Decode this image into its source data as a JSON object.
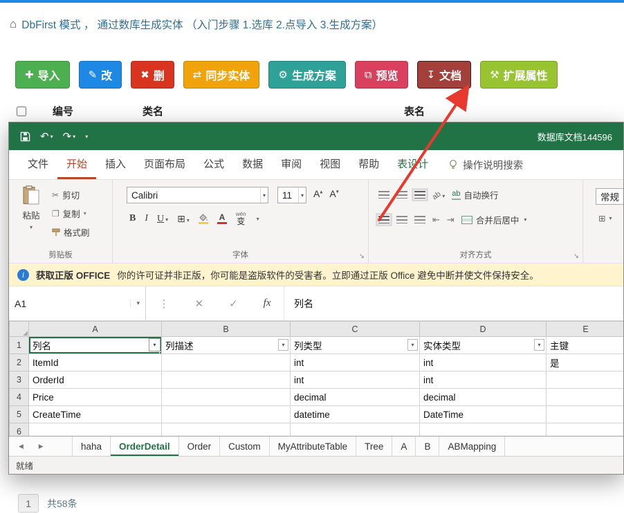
{
  "colors": {
    "top_strip": "#1E88E5",
    "excel_green": "#217346",
    "active_ribbon_tab": "#B7472A",
    "warning_bg": "#FFF4CE",
    "btn_import": "#4CAF50",
    "btn_modify": "#1E88E5",
    "btn_delete": "#D9341F",
    "btn_sync": "#F0A30A",
    "btn_generate": "#2FA199",
    "btn_preview": "#D8405D",
    "btn_doc": "#A3403C",
    "btn_extend": "#97C430",
    "annotation_arrow": "#E8392E",
    "font_color_swatch": "#D32F2F",
    "fill_color_swatch": "#F2CE3A"
  },
  "icons": {
    "home": "⌂",
    "plus": "✚",
    "edit": "✎",
    "delete": "✖",
    "sync": "⇄",
    "gear": "⚙",
    "preview": "⧉",
    "download": "↧",
    "extend": "⚒",
    "undo": "↶",
    "redo": "↷",
    "dropdown": "▾",
    "cut": "✂",
    "copy": "❐",
    "borders": "⊞",
    "nav_left": "◂",
    "nav_right": "▸",
    "cancel": "✕",
    "confirm": "✓",
    "dots": "⋮",
    "launcher": "↘",
    "corner_triangle": "◢",
    "indent_decrease": "⇤",
    "indent_increase": "⇥",
    "letter_a": "A",
    "grow_mark": "▴",
    "shrink_mark": "▾"
  },
  "page": {
    "header_title": "DbFirst 模式 ，  通过数库生成实体 （入门步骤 1.选库 2.点导入 3.生成方案）",
    "toolbar": {
      "buttons": [
        {
          "label": "导入"
        },
        {
          "label": "改"
        },
        {
          "label": "删"
        },
        {
          "label": "同步实体"
        },
        {
          "label": "生成方案"
        },
        {
          "label": "预览"
        },
        {
          "label": "文档"
        },
        {
          "label": "扩展属性"
        }
      ]
    },
    "table_headers": [
      "编号",
      "类名",
      "表名"
    ],
    "pagination": {
      "page": "1",
      "total": "共58条"
    }
  },
  "excel": {
    "title": "数据库文档144596",
    "menu": {
      "tabs": [
        "文件",
        "开始",
        "插入",
        "页面布局",
        "公式",
        "数据",
        "审阅",
        "视图",
        "帮助",
        "表设计"
      ],
      "search": "操作说明搜索"
    },
    "ribbon": {
      "paste": "粘贴",
      "cut": "剪切",
      "copy": "复制",
      "format_painter": "格式刷",
      "clipboard_label": "剪贴板",
      "font_family": "Calibri",
      "font_size": "11",
      "bold": "B",
      "italic": "I",
      "underline": "U",
      "phonetic_pinyin": "wén",
      "phonetic_char": "变",
      "font_label": "字体",
      "orientation_icon": "ab",
      "wrap_icon": "ab",
      "wrap": "自动换行",
      "merge": "合并后居中",
      "align_label": "对齐方式",
      "number_format": "常规"
    },
    "warning": {
      "title": "获取正版 OFFICE",
      "message": "你的许可证并非正版，你可能是盗版软件的受害者。立即通过正版 Office 避免中断并使文件保持安全。"
    },
    "formula": {
      "cell_ref": "A1",
      "fx": "fx",
      "content": "列名"
    },
    "grid": {
      "columns": [
        "A",
        "B",
        "C",
        "D",
        "E"
      ],
      "rows": [
        {
          "n": "1",
          "cells": [
            "列名",
            "列描述",
            "列类型",
            "实体类型",
            "主键"
          ]
        },
        {
          "n": "2",
          "cells": [
            "ItemId",
            "",
            "int",
            "int",
            "是"
          ]
        },
        {
          "n": "3",
          "cells": [
            "OrderId",
            "",
            "int",
            "int",
            ""
          ]
        },
        {
          "n": "4",
          "cells": [
            "Price",
            "",
            "decimal",
            "decimal",
            ""
          ]
        },
        {
          "n": "5",
          "cells": [
            "CreateTime",
            "",
            "datetime",
            "DateTime",
            ""
          ]
        },
        {
          "n": "6",
          "cells": [
            "",
            "",
            "",
            "",
            ""
          ]
        }
      ]
    },
    "sheets": {
      "tabs": [
        "haha",
        "OrderDetail",
        "Order",
        "Custom",
        "MyAttributeTable",
        "Tree",
        "A",
        "B",
        "ABMapping"
      ]
    },
    "status": "就绪"
  }
}
